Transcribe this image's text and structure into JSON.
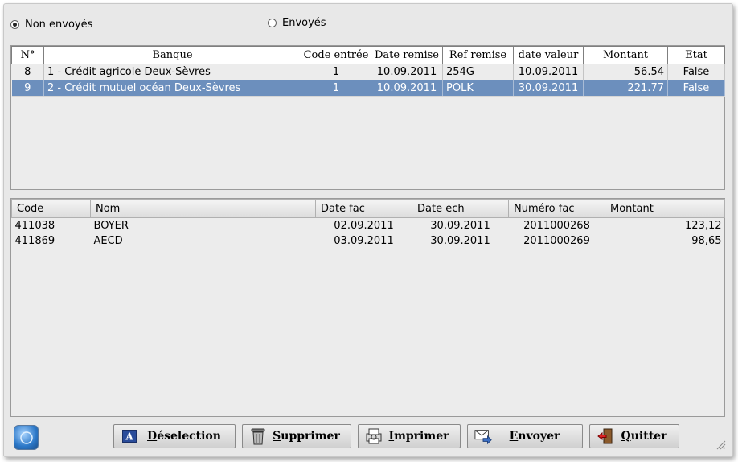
{
  "filter": {
    "option_unsent": "Non envoyés",
    "option_sent": "Envoyés",
    "selected": "unsent"
  },
  "remises": {
    "columns": [
      "N°",
      "Banque",
      "Code entrée",
      "Date remise",
      "Ref remise",
      "date valeur",
      "Montant",
      "Etat"
    ],
    "rows": [
      {
        "num": "8",
        "banque": "1 - Crédit agricole Deux-Sèvres",
        "code": "1",
        "date_remise": "10.09.2011",
        "ref": "254G",
        "date_valeur": "10.09.2011",
        "montant": "56.54",
        "etat": "False"
      },
      {
        "num": "9",
        "banque": "2 - Crédit mutuel océan Deux-Sèvres",
        "code": "1",
        "date_remise": "10.09.2011",
        "ref": "POLK",
        "date_valeur": "30.09.2011",
        "montant": "221.77",
        "etat": "False"
      }
    ],
    "selected_row": 1,
    "selection_color": "#6c8fbd"
  },
  "factures": {
    "columns": [
      "Code",
      "Nom",
      "Date fac",
      "Date ech",
      "Numéro fac",
      "Montant"
    ],
    "rows": [
      {
        "code": "411038",
        "nom": "BOYER",
        "date_fac": "02.09.2011",
        "date_ech": "30.09.2011",
        "numero": "2011000268",
        "montant": "123,12"
      },
      {
        "code": "411869",
        "nom": "AECD",
        "date_fac": "03.09.2011",
        "date_ech": "30.09.2011",
        "numero": "2011000269",
        "montant": "98,65"
      }
    ]
  },
  "buttons": {
    "deselect": "Déselection",
    "delete": "Supprimer",
    "print": "Imprimer",
    "send": "Envoyer",
    "quit": "Quitter"
  },
  "icons": {
    "help": "help-icon",
    "deselect": "letter-a-icon",
    "delete": "trash-icon",
    "print": "printer-icon",
    "send": "envelope-icon",
    "quit": "exit-door-icon"
  }
}
